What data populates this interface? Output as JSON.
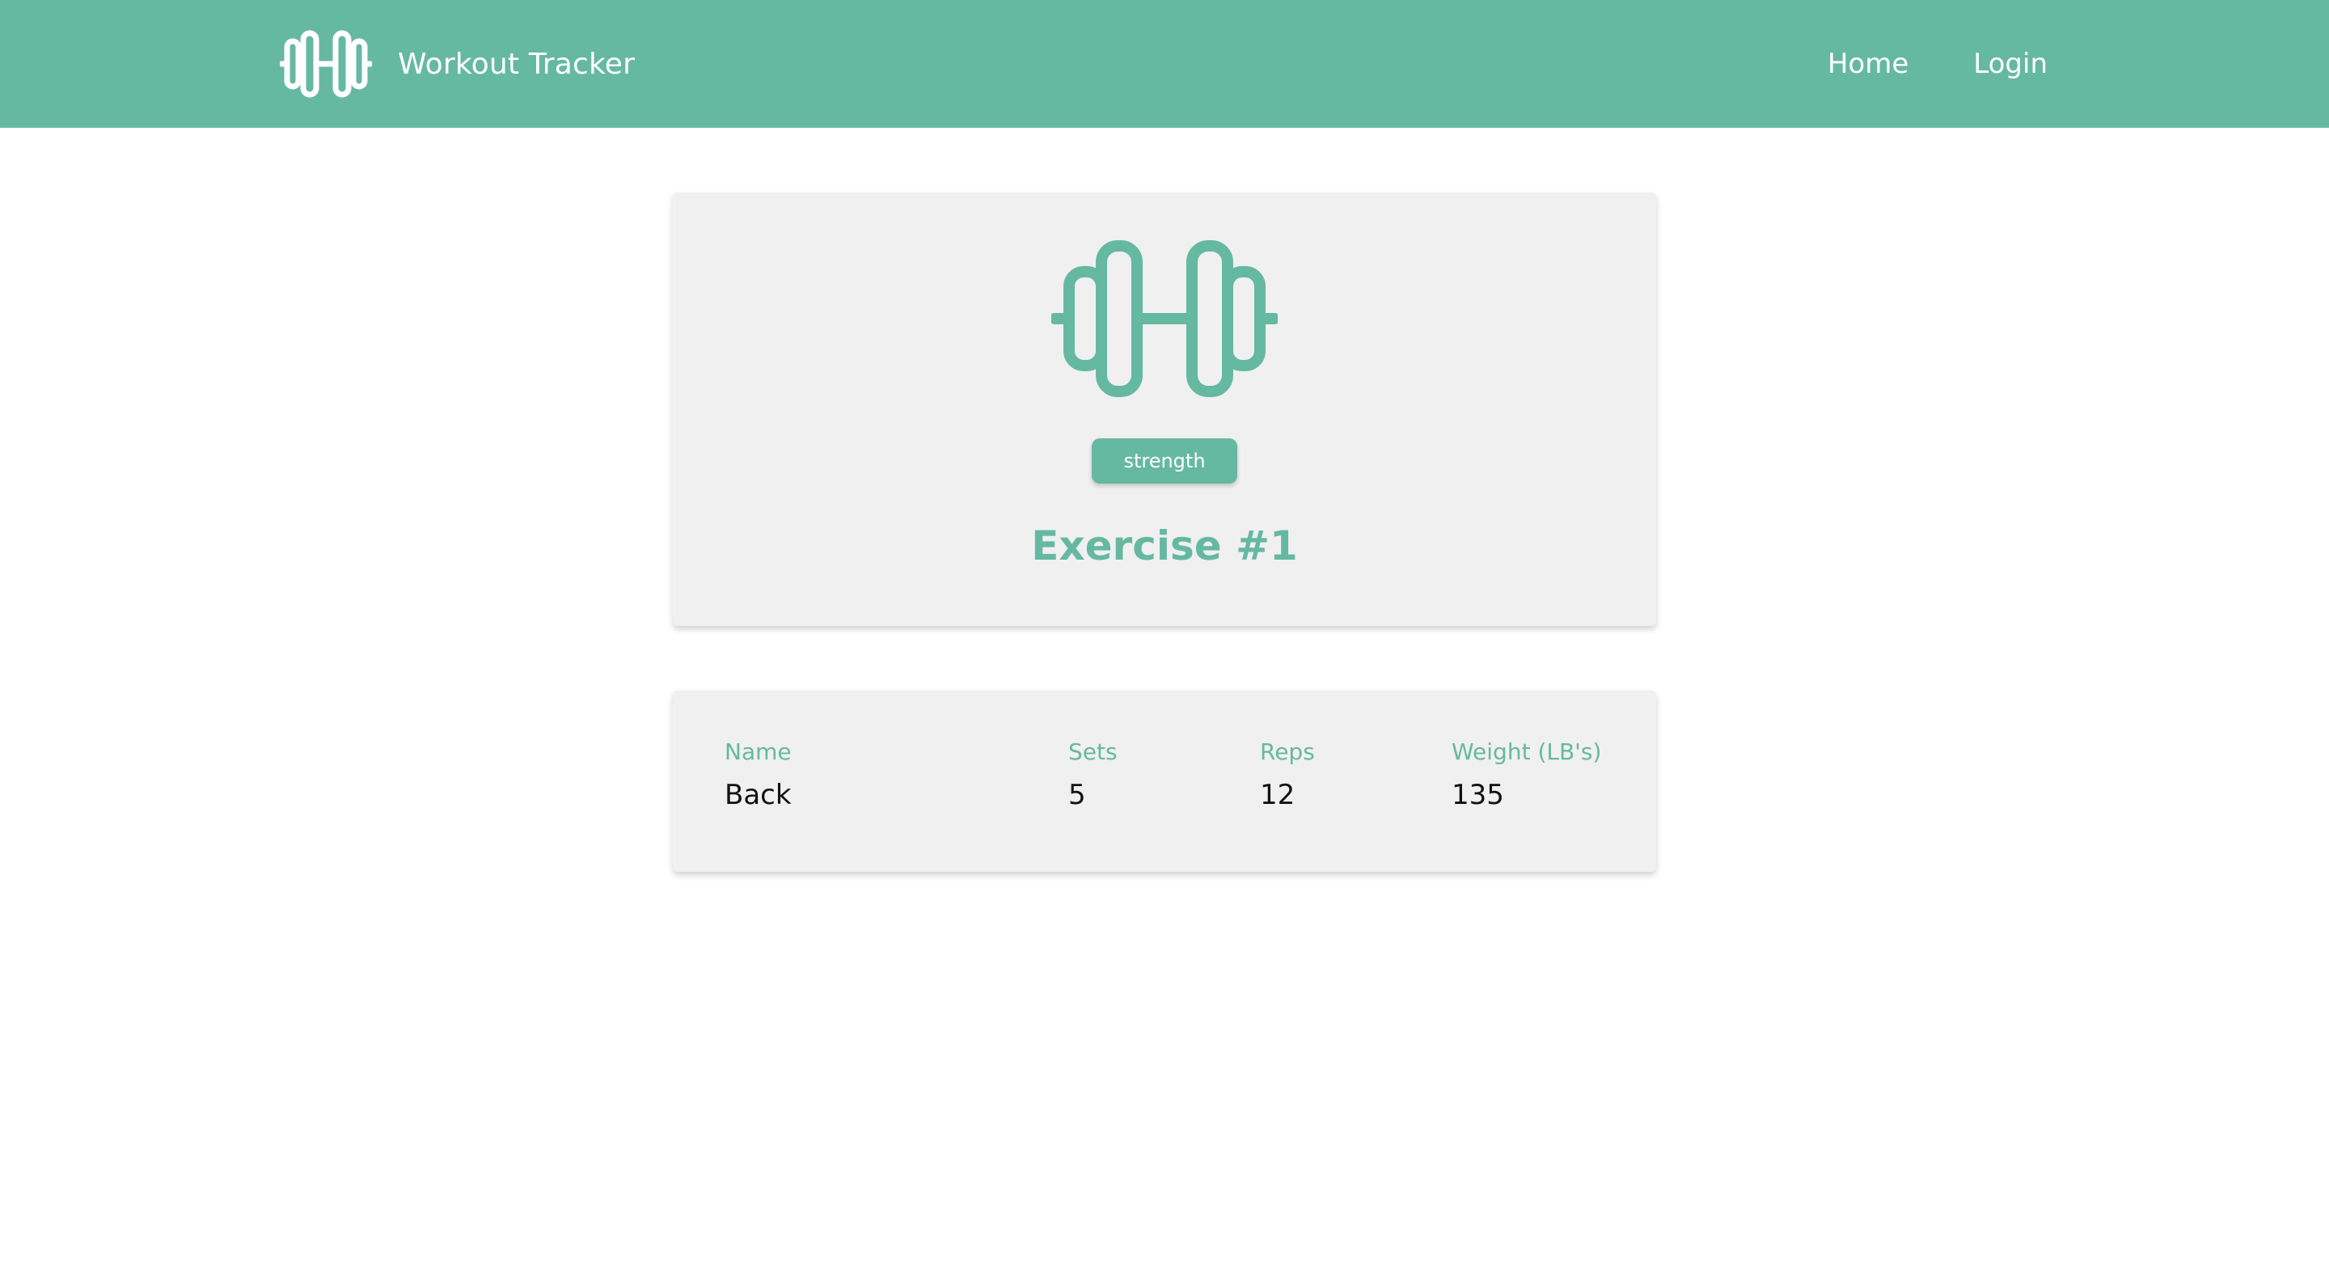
{
  "navbar": {
    "brand_icon": "dumbbell-icon",
    "brand_text": "Workout Tracker",
    "links": [
      "Home",
      "Login"
    ]
  },
  "exercise": {
    "icon": "dumbbell-icon",
    "type": "strength",
    "title": "Exercise #1"
  },
  "stats": [
    {
      "label": "Name",
      "value": "Back"
    },
    {
      "label": "Sets",
      "value": "5"
    },
    {
      "label": "Reps",
      "value": "12"
    },
    {
      "label": "Weight (LB's)",
      "value": "135"
    }
  ],
  "colors": {
    "accent": "#66b9a1",
    "card_bg": "#f0f0f0",
    "text": "#111111"
  }
}
